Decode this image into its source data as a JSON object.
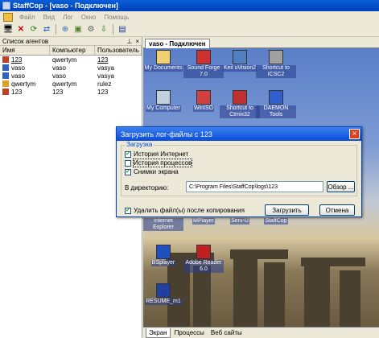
{
  "window": {
    "title": "StaffCop - [vaso - Подключен]"
  },
  "menu": [
    "Файл",
    "Вид",
    "Лог",
    "Окно",
    "Помощь"
  ],
  "toolbar": {
    "icons": [
      "computer-icon",
      "delete-icon",
      "refresh-icon",
      "connect-icon",
      "network-icon",
      "screenshot-icon",
      "settings-icon",
      "download-icon",
      "save-icon"
    ]
  },
  "agents_panel": {
    "title": "Список агентов",
    "pin": "⊥",
    "close": "×",
    "columns": [
      "Имя",
      "Компьютер",
      "Пользователь"
    ],
    "rows": [
      {
        "name": "123",
        "computer": "qwertym",
        "user": "123",
        "icon_color": "#c04020"
      },
      {
        "name": "vaso",
        "computer": "vaso",
        "user": "vasya",
        "icon_color": "#3060c0"
      },
      {
        "name": "vaso",
        "computer": "vaso",
        "user": "vasya",
        "icon_color": "#3060c0"
      },
      {
        "name": "qwertym",
        "computer": "qwertym",
        "user": "rulez",
        "icon_color": "#e0a020"
      },
      {
        "name": "123",
        "computer": "123",
        "user": "123",
        "icon_color": "#c04020"
      }
    ]
  },
  "main_tab": {
    "label": "vaso - Подключен"
  },
  "desktop_icons": [
    {
      "label": "My Documents",
      "color": "#f0d070"
    },
    {
      "label": "Sound Forge 7.0",
      "color": "#d03030"
    },
    {
      "label": "Keil uVision2",
      "color": "#5080c0"
    },
    {
      "label": "Shortcut to ICSC2",
      "color": "#a0a0a0"
    },
    {
      "label": "My Computer",
      "color": "#c0d0e0"
    },
    {
      "label": "WinISO",
      "color": "#d04040"
    },
    {
      "label": "Shortcut to Ctmix32",
      "color": "#c03030"
    },
    {
      "label": "DAEMON Tools",
      "color": "#3060d0"
    },
    {
      "label": "Internet Explorer",
      "color": "#4080e0"
    },
    {
      "label": "MPlayer",
      "color": "#3050a0"
    },
    {
      "label": "Serv-U",
      "color": "#80a040"
    },
    {
      "label": "StaffCop",
      "color": "#4060a0"
    },
    {
      "label": "BSplayer",
      "color": "#2050c0"
    },
    {
      "label": "Adobe Reader 6.0",
      "color": "#c02020"
    },
    {
      "label": "RESUME_m1",
      "color": "#2040a0"
    }
  ],
  "bottom_tabs": [
    "Экран",
    "Процессы",
    "Веб сайты"
  ],
  "dialog": {
    "title": "Загрузить лог-файлы с 123",
    "close": "×",
    "group_title": "Загрузка",
    "checkboxes": [
      {
        "label": "История Интернет",
        "checked": true
      },
      {
        "label": "История процессов",
        "checked": false
      },
      {
        "label": "Снимки экрана",
        "checked": true
      }
    ],
    "dir_label": "В директорию:",
    "dir_value": "C:\\Program Files\\StaffCop\\logs\\123",
    "browse_label": "Обзор ...",
    "delete_label": "Удалить файл(ы) после копирования",
    "delete_checked": true,
    "load_label": "Загрузить",
    "cancel_label": "Отмена"
  }
}
